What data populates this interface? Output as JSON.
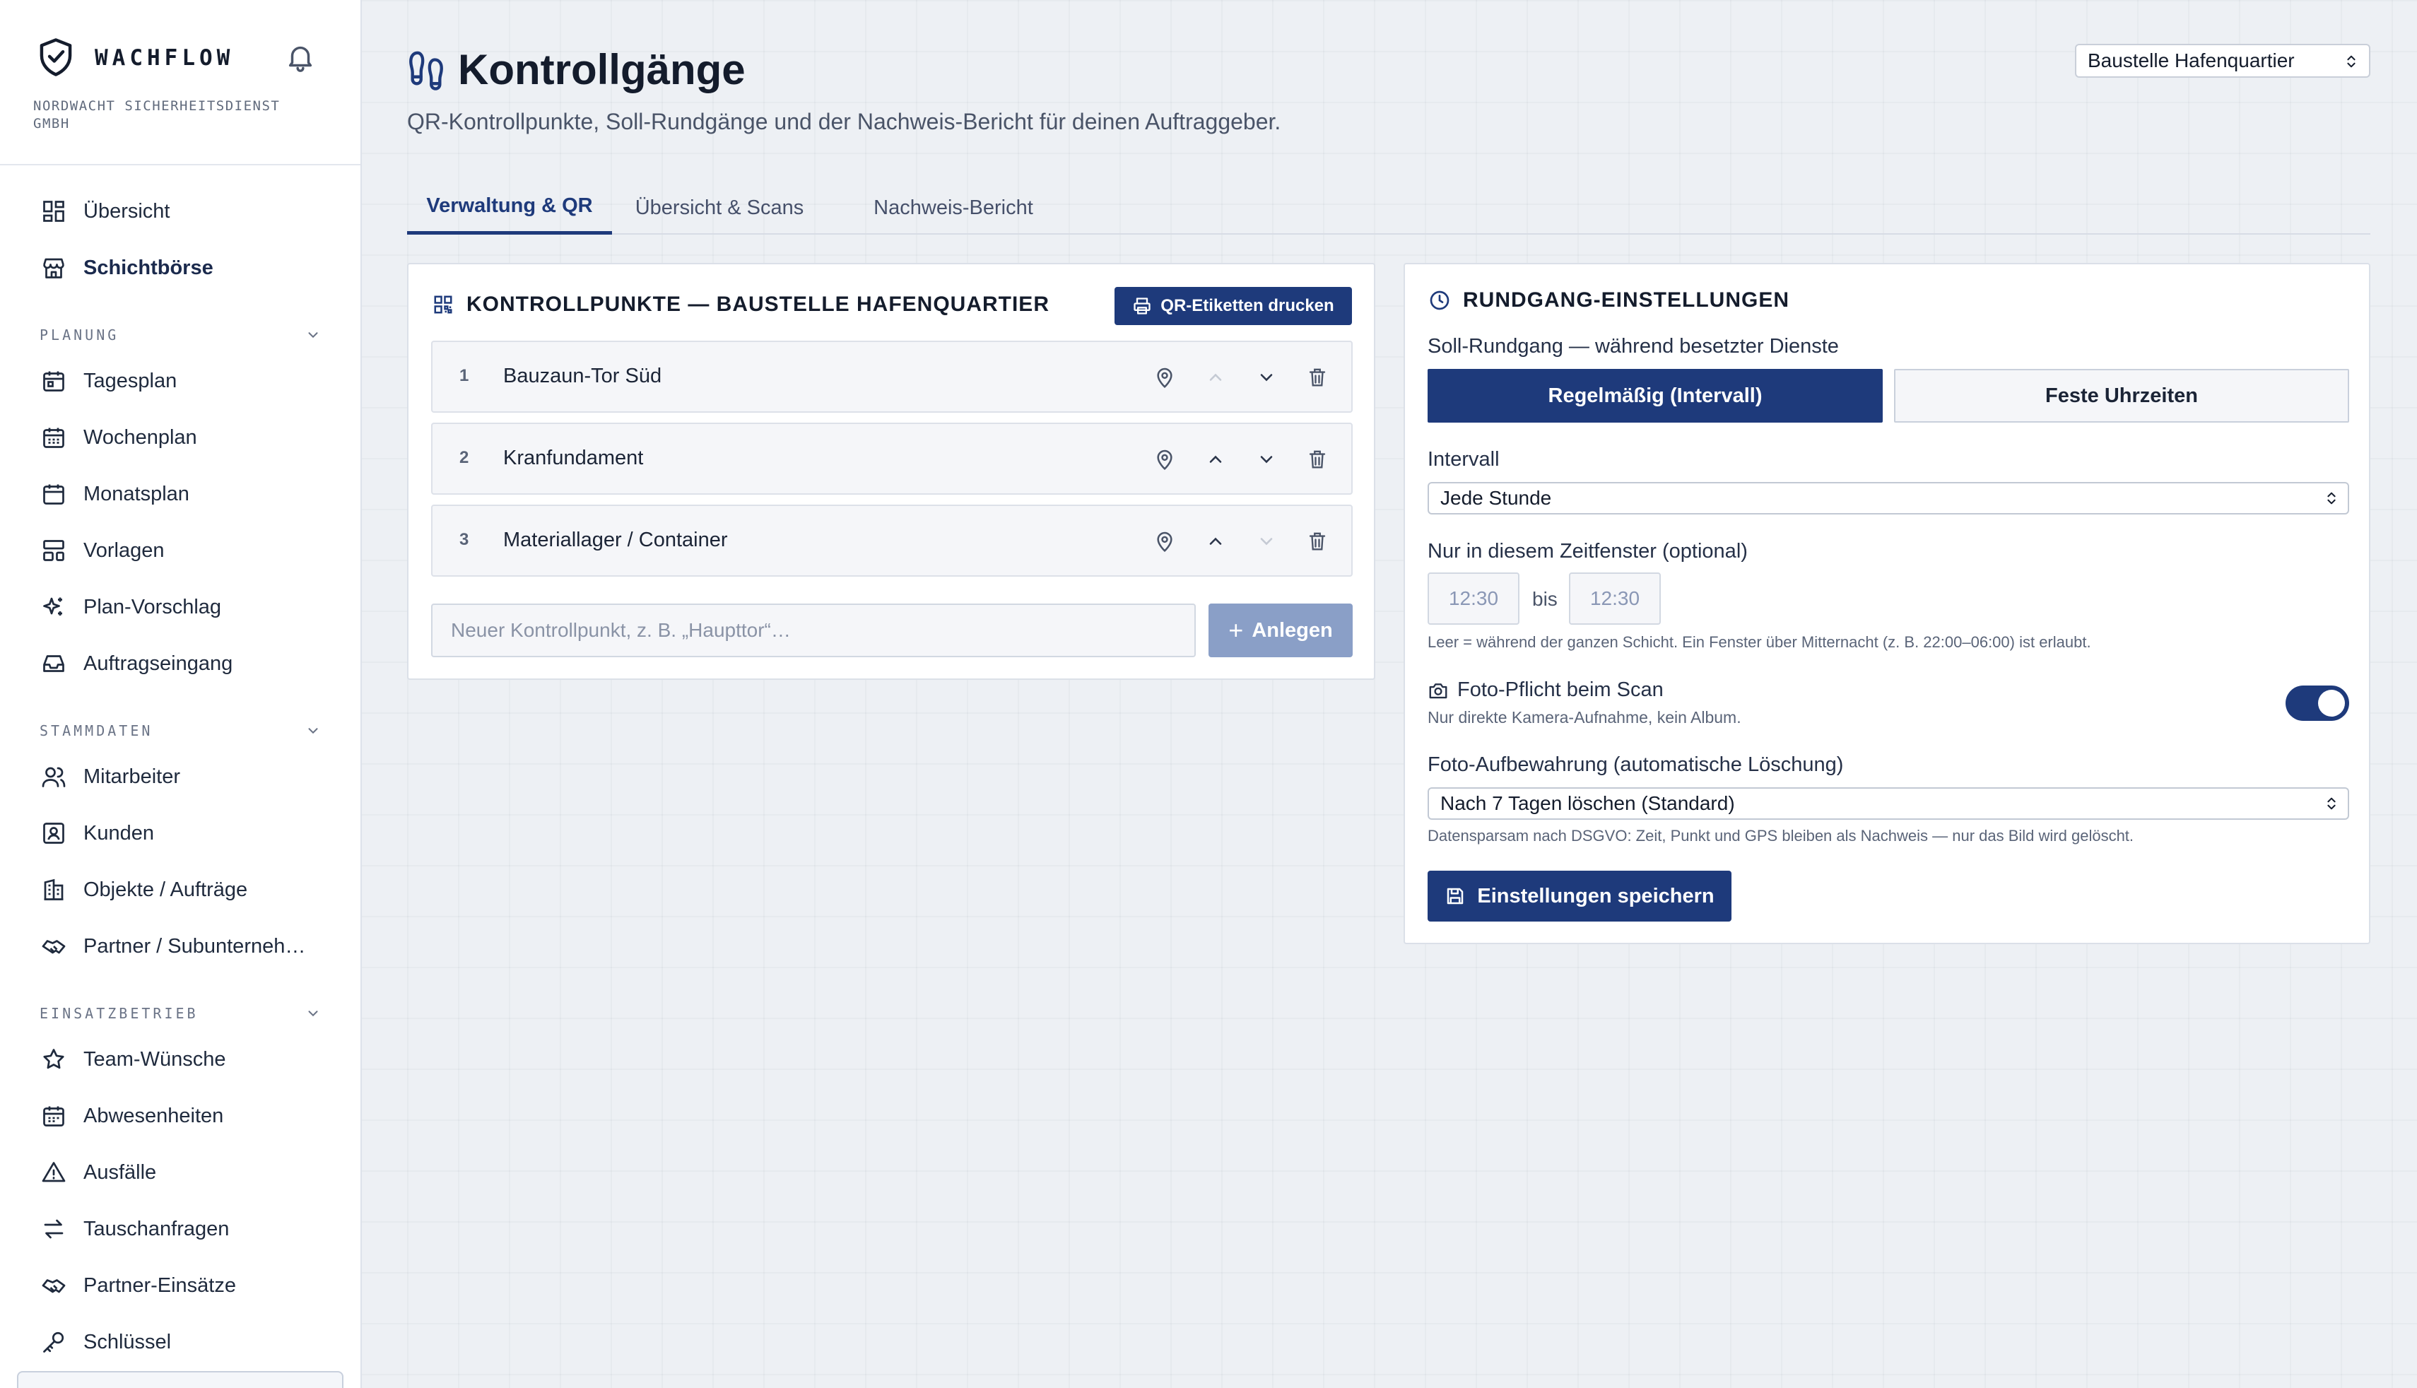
{
  "brand": {
    "name": "WACHFLOW",
    "company": "NORDWACHT SICHERHEITSDIENST GMBH"
  },
  "sidebar": {
    "top_items": [
      {
        "label": "Übersicht",
        "icon": "dashboard-icon"
      },
      {
        "label": "Schichtbörse",
        "icon": "store-icon",
        "active": true
      }
    ],
    "sections": [
      {
        "title": "PLANUNG",
        "items": [
          "Tagesplan",
          "Wochenplan",
          "Monatsplan",
          "Vorlagen",
          "Plan-Vorschlag",
          "Auftragseingang"
        ]
      },
      {
        "title": "STAMMDATEN",
        "items": [
          "Mitarbeiter",
          "Kunden",
          "Objekte / Aufträge",
          "Partner / Subunterneh…"
        ]
      },
      {
        "title": "EINSATZBETRIEB",
        "items": [
          "Team-Wünsche",
          "Abwesenheiten",
          "Ausfälle",
          "Tauschanfragen",
          "Partner-Einsätze",
          "Schlüssel"
        ]
      }
    ]
  },
  "header": {
    "title": "Kontrollgänge",
    "subtitle": "QR-Kontrollpunkte, Soll-Rundgänge und der Nachweis-Bericht für deinen Auftraggeber.",
    "site_select": "Baustelle Hafenquartier"
  },
  "tabs": [
    "Verwaltung & QR",
    "Übersicht & Scans",
    "Nachweis-Bericht"
  ],
  "checkpoints": {
    "title": "KONTROLLPUNKTE — BAUSTELLE HAFENQUARTIER",
    "print_button": "QR-Etiketten drucken",
    "items": [
      {
        "num": "1",
        "name": "Bauzaun-Tor Süd"
      },
      {
        "num": "2",
        "name": "Kranfundament"
      },
      {
        "num": "3",
        "name": "Materiallager / Container"
      }
    ],
    "new_placeholder": "Neuer Kontrollpunkt, z. B. „Haupttor“…",
    "add_button": "Anlegen"
  },
  "settings": {
    "title": "RUNDGANG-EINSTELLUNGEN",
    "soll_label": "Soll-Rundgang — während besetzter Dienste",
    "mode_a": "Regelmäßig (Intervall)",
    "mode_b": "Feste Uhrzeiten",
    "interval_label": "Intervall",
    "interval_value": "Jede Stunde",
    "window_label": "Nur in diesem Zeitfenster (optional)",
    "time_from": "12:30",
    "time_to": "12:30",
    "bis": "bis",
    "window_hint": "Leer = während der ganzen Schicht. Ein Fenster über Mitternacht (z. B. 22:00–06:00) ist erlaubt.",
    "photo_label": "Foto-Pflicht beim Scan",
    "photo_hint": "Nur direkte Kamera-Aufnahme, kein Album.",
    "photo_required": true,
    "retention_label": "Foto-Aufbewahrung (automatische Löschung)",
    "retention_value": "Nach 7 Tagen löschen (Standard)",
    "retention_hint": "Datensparsam nach DSGVO: Zeit, Punkt und GPS bleiben als Nachweis — nur das Bild wird gelöscht.",
    "save_button": "Einstellungen speichern"
  },
  "colors": {
    "primary": "#1e3a7b",
    "primary_disabled": "#8a9fc7",
    "background": "#edf0f4"
  }
}
